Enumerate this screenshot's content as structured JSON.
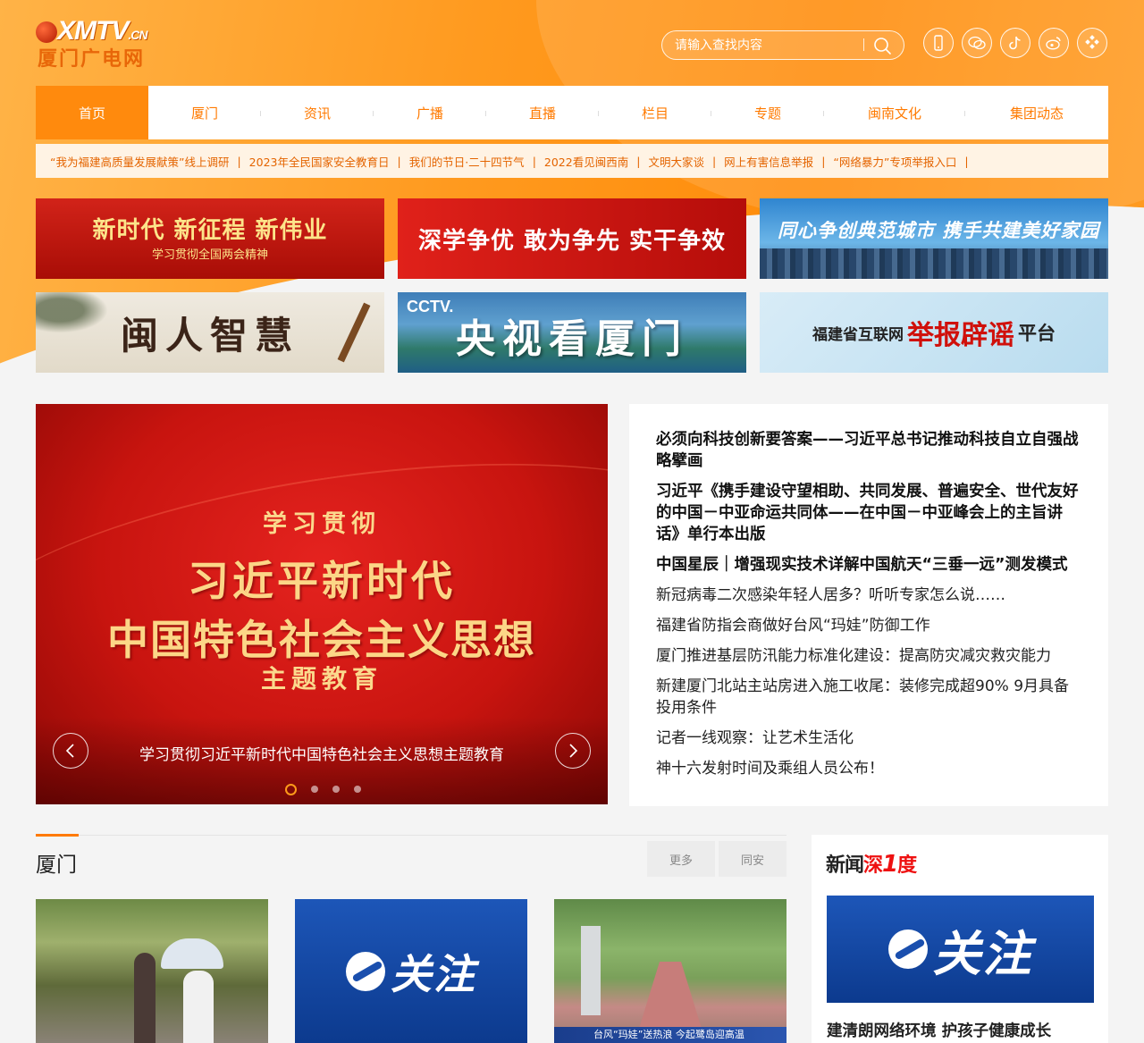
{
  "header": {
    "logo_en": "XMTV",
    "logo_en_suffix": ".CN",
    "logo_cn": "厦门广电网",
    "search_placeholder": "请输入查找内容",
    "social_icons": [
      "mobile-icon",
      "wechat-icon",
      "douyin-icon",
      "weibo-icon",
      "app-icon"
    ]
  },
  "nav": {
    "items": [
      {
        "label": "首页",
        "active": true
      },
      {
        "label": "厦门"
      },
      {
        "label": "资讯"
      },
      {
        "label": "广播"
      },
      {
        "label": "直播"
      },
      {
        "label": "栏目"
      },
      {
        "label": "专题"
      },
      {
        "label": "闽南文化"
      },
      {
        "label": "集团动态"
      }
    ]
  },
  "quicklinks": [
    "“我为福建高质量发展献策”线上调研",
    "2023年全民国家安全教育日",
    "我们的节日·二十四节气",
    "2022看见闽西南",
    "文明大家谈",
    "网上有害信息举报",
    "“网络暴力”专项举报入口"
  ],
  "banners": {
    "b1_title": "新时代 新征程 新伟业",
    "b1_sub": "学习贯彻全国两会精神",
    "b2_title": "深学争优 敢为争先 实干争效",
    "b3_title": "同心争创典范城市 携手共建美好家园",
    "b4_title": "闽人智慧",
    "b5_brand": "CCTV.",
    "b5_title": "央视看厦门",
    "b6_pre": "福建省互联网",
    "b6_red": "举报辟谣",
    "b6_post": "平台"
  },
  "slider": {
    "sub1": "学习贯彻",
    "big1": "习近平新时代",
    "big2": "中国特色社会主义思想",
    "sub2": "主题教育",
    "caption": "学习贯彻习近平新时代中国特色社会主义思想主题教育",
    "active_index": 0,
    "dot_count": 4
  },
  "headlines": {
    "bold": [
      "必须向科技创新要答案——习近平总书记推动科技自立自强战略擘画",
      "习近平《携手建设守望相助、共同发展、普遍安全、世代友好的中国－中亚命运共同体——在中国－中亚峰会上的主旨讲话》单行本出版",
      "中国星辰｜增强现实技术详解中国航天“三垂一远”测发模式"
    ],
    "normal": [
      "新冠病毒二次感染年轻人居多？听听专家怎么说……",
      "福建省防指会商做好台风“玛娃”防御工作",
      "厦门推进基层防汛能力标准化建设：提高防灾减灾救灾能力",
      "新建厦门北站主站房进入施工收尾：装修完成超90% 9月具备投用条件",
      "记者一线观察：让艺术生活化",
      "神十六发射时间及乘组人员公布！"
    ]
  },
  "xiamen": {
    "title": "厦门",
    "more": "更多",
    "tongan": "同安",
    "thumb2_text": "关注",
    "thumb3_caption": "台风“玛娃”送热浪 今起鹭岛迎高温"
  },
  "side": {
    "brand_a": "新闻",
    "brand_b": "深",
    "brand_c": "1",
    "brand_d": "度",
    "img_text": "关注",
    "title": "建清朗网络环境 护孩子健康成长"
  },
  "colors": {
    "accent": "#ff8a0d",
    "nav_text": "#ff7a00",
    "quicklinks_bg": "#fff3e4"
  }
}
